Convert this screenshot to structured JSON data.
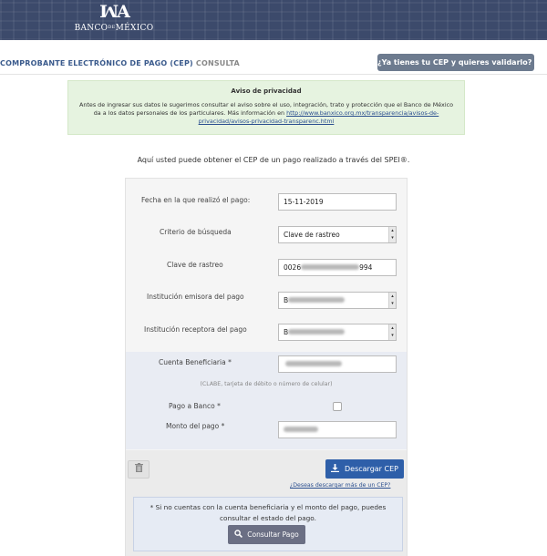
{
  "header": {
    "logo_mark": "ꟽA",
    "logo_name_left": "BANCO",
    "logo_name_mid": "DE",
    "logo_name_right": "MÉXICO"
  },
  "subbar": {
    "title_main": "COMPROBANTE ELECTRÓNICO DE PAGO (CEP)",
    "title_sub": "CONSULTA",
    "validate_label": "¿Ya tienes tu CEP y quieres validarlo?"
  },
  "privacy": {
    "title": "Aviso de privacidad",
    "body": "Antes de ingresar sus datos le sugerimos consultar el aviso sobre el uso, integración, trato y protección que el Banco de México da a los datos personales de los particulares. Más información en ",
    "link": "http://www.banxico.org.mx/transparencia/avisos-de-privacidad/avisos-privacidad-transparenc.html"
  },
  "intro": "Aquí usted puede obtener el CEP de un pago realizado a través del SPEI®.",
  "form": {
    "fecha_label": "Fecha en la que realizó el pago:",
    "fecha_value": "15-11-2019",
    "criterio_label": "Criterio de búsqueda",
    "criterio_value": "Clave de rastreo",
    "clave_label": "Clave de rastreo",
    "clave_prefix": "0026",
    "clave_suffix": "994",
    "emisora_label": "Institución emisora del pago",
    "emisora_value_prefix": "B",
    "receptora_label": "Institución receptora del pago",
    "receptora_value_prefix": "B",
    "cuenta_label": "Cuenta Beneficiaria *",
    "cuenta_hint": "(CLABE, tarjeta de débito o número de celular)",
    "pago_banco_label": "Pago a Banco *",
    "pago_banco_checked": false,
    "monto_label": "Monto del pago *"
  },
  "actions": {
    "download_label": "Descargar CEP",
    "more_link": "¿Deseas descargar más de un CEP?",
    "notice": "* Si no cuentas con la cuenta beneficiaria y el monto del pago, puedes consultar el estado del pago.",
    "consult_label": "Consultar Pago"
  },
  "colors": {
    "header_bg": "#3c4a6b",
    "privacy_bg": "#e6f3e0",
    "primary_button": "#2e5fa9",
    "secondary_button": "#6b6f84",
    "validate_button": "#6d7b8f"
  }
}
